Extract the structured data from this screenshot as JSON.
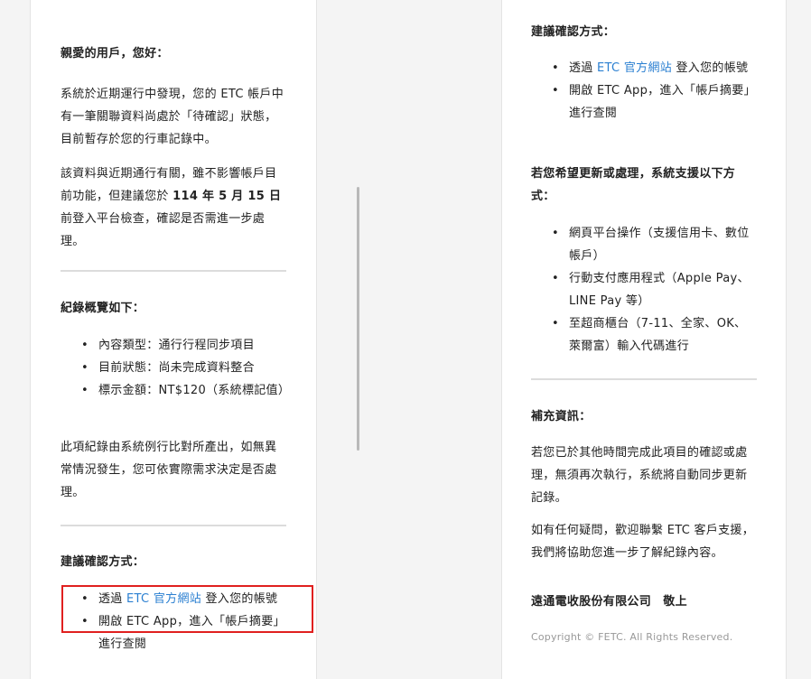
{
  "left": {
    "greeting": "親愛的用戶，您好：",
    "para1": "系統於近期運行中發現，您的 ETC 帳戶中有一筆關聯資料尚處於「待確認」狀態，目前暫存於您的行車記錄中。",
    "para2_a": "該資料與近期通行有關，雖不影響帳戶目前功能，但建議您於 ",
    "para2_date": "114 年 5 月 15 日",
    "para2_b": "前登入平台檢查，確認是否需進一步處理。",
    "overview_title": "紀錄概覽如下：",
    "overview_items": [
      "內容類型：通行行程同步項目",
      "目前狀態：尚未完成資料整合",
      "標示金額：NT$120（系統標記值）"
    ],
    "para3": "此項紀錄由系統例行比對所產出，如無異常情況發生，您可依實際需求決定是否處理。",
    "confirm_title": "建議確認方式：",
    "confirm_item1_a": "透過 ",
    "confirm_item1_link": "ETC 官方網站",
    "confirm_item1_b": " 登入您的帳號",
    "confirm_item2": "開啟 ETC App，進入「帳戶摘要」進行查閱"
  },
  "right": {
    "confirm_title": "建議確認方式：",
    "confirm_item1_a": "透過 ",
    "confirm_item1_link": "ETC 官方網站",
    "confirm_item1_b": " 登入您的帳號",
    "confirm_item2": "開啟 ETC App，進入「帳戶摘要」進行查閱",
    "update_title": "若您希望更新或處理，系統支援以下方式：",
    "update_items": [
      "網頁平台操作（支援信用卡、數位帳戶）",
      "行動支付應用程式（Apple Pay、LINE Pay 等）",
      "至超商櫃台（7-11、全家、OK、萊爾富）輸入代碼進行"
    ],
    "extra_title": "補充資訊：",
    "extra_para1": "若您已於其他時間完成此項目的確認或處理，無須再次執行，系統將自動同步更新記錄。",
    "extra_para2": "如有任何疑問，歡迎聯繫 ETC 客戶支援，我們將協助您進一步了解紀錄內容。",
    "signature": "遠通電收股份有限公司　敬上",
    "copyright": "Copyright © FETC. All Rights Reserved."
  },
  "colors": {
    "link": "#2a7fd1",
    "highlight_box": "#e0201f"
  }
}
